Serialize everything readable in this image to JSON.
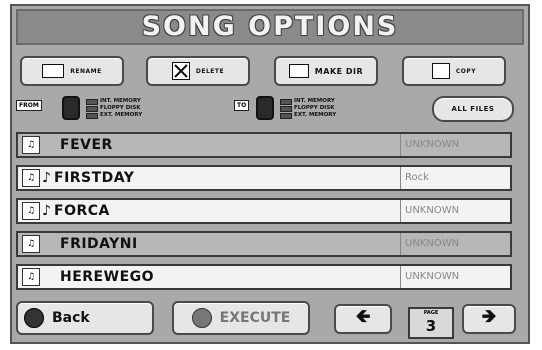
{
  "title": "SONG OPTIONS",
  "toolbar": {
    "rename": "RENAME",
    "delete": "DELETE",
    "mkdir_label": "MAKE DIR",
    "copy": "COPY"
  },
  "from": {
    "tag": "FROM",
    "options": [
      "INT. MEMORY",
      "FLOPPY DISK",
      "EXT. MEMORY"
    ]
  },
  "to": {
    "tag": "TO",
    "options": [
      "INT. MEMORY",
      "FLOPPY DISK",
      "EXT. MEMORY"
    ]
  },
  "all_files": "ALL FILES",
  "songs": [
    {
      "name": "FEVER",
      "style": "UNKNOWN",
      "selected": true,
      "note": false
    },
    {
      "name": "FIRSTDAY",
      "style": "Rock",
      "selected": false,
      "note": true
    },
    {
      "name": "FORCA",
      "style": "UNKNOWN",
      "selected": false,
      "note": true
    },
    {
      "name": "FRIDAYNI",
      "style": "UNKNOWN",
      "selected": true,
      "note": false
    },
    {
      "name": "HEREWEGO",
      "style": "UNKNOWN",
      "selected": false,
      "note": false
    }
  ],
  "bottom": {
    "back": "Back",
    "execute": "EXECUTE",
    "page_label": "PAGE",
    "page_number": "3"
  },
  "colors": {
    "panel": "#a9a9a9",
    "button": "#e6e6e6",
    "selected_row": "#b7b7b7"
  }
}
